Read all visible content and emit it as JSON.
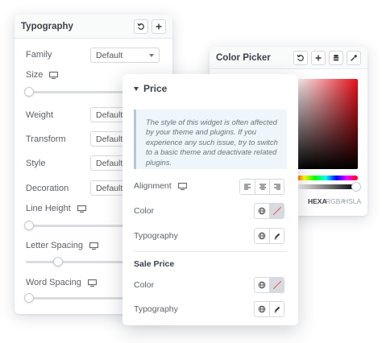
{
  "typography": {
    "title": "Typography",
    "rows": {
      "family": {
        "label": "Family",
        "value": "Default"
      },
      "size": {
        "label": "Size"
      },
      "weight": {
        "label": "Weight",
        "value": "Default"
      },
      "transform": {
        "label": "Transform",
        "value": "Default"
      },
      "style": {
        "label": "Style",
        "value": "Default"
      },
      "decoration": {
        "label": "Decoration",
        "value": "Default"
      },
      "line_height": {
        "label": "Line Height"
      },
      "letter_spacing": {
        "label": "Letter Spacing"
      },
      "word_spacing": {
        "label": "Word Spacing"
      }
    }
  },
  "color_picker": {
    "title": "Color Picker",
    "formats": [
      "HEXA",
      "RGBA",
      "HSLA"
    ],
    "active_format": "HEXA",
    "hue_color": "#e3101a"
  },
  "price": {
    "title": "Price",
    "notice": "The style of this widget is often affected by your theme and plugins. If you experience any such issue, try to switch to a basic theme and deactivate related plugins.",
    "alignment_label": "Alignment",
    "color_label": "Color",
    "typography_label": "Typography",
    "sale_title": "Sale Price",
    "sale_color_label": "Color",
    "sale_typography_label": "Typography"
  }
}
